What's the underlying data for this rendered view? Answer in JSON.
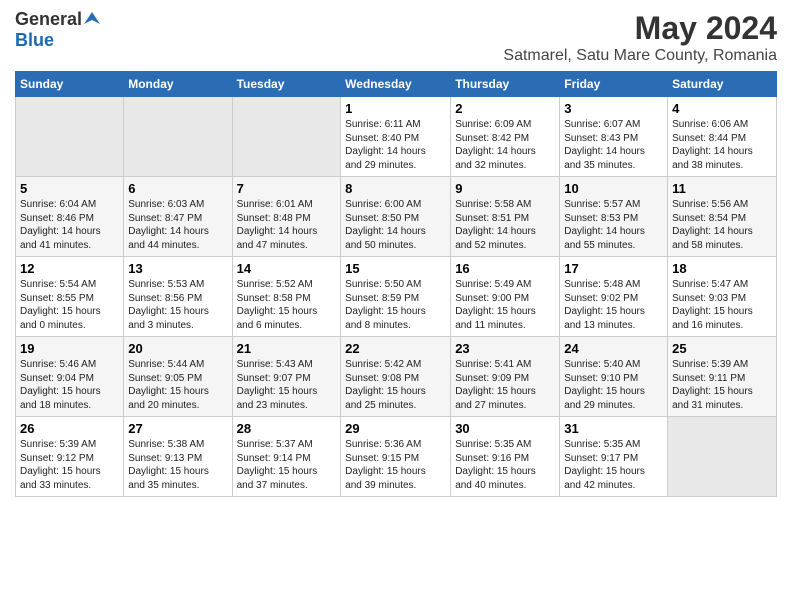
{
  "header": {
    "logo_general": "General",
    "logo_blue": "Blue",
    "title": "May 2024",
    "subtitle": "Satmarel, Satu Mare County, Romania"
  },
  "days_of_week": [
    "Sunday",
    "Monday",
    "Tuesday",
    "Wednesday",
    "Thursday",
    "Friday",
    "Saturday"
  ],
  "weeks": [
    [
      {
        "day": "",
        "info": ""
      },
      {
        "day": "",
        "info": ""
      },
      {
        "day": "",
        "info": ""
      },
      {
        "day": "1",
        "info": "Sunrise: 6:11 AM\nSunset: 8:40 PM\nDaylight: 14 hours\nand 29 minutes."
      },
      {
        "day": "2",
        "info": "Sunrise: 6:09 AM\nSunset: 8:42 PM\nDaylight: 14 hours\nand 32 minutes."
      },
      {
        "day": "3",
        "info": "Sunrise: 6:07 AM\nSunset: 8:43 PM\nDaylight: 14 hours\nand 35 minutes."
      },
      {
        "day": "4",
        "info": "Sunrise: 6:06 AM\nSunset: 8:44 PM\nDaylight: 14 hours\nand 38 minutes."
      }
    ],
    [
      {
        "day": "5",
        "info": "Sunrise: 6:04 AM\nSunset: 8:46 PM\nDaylight: 14 hours\nand 41 minutes."
      },
      {
        "day": "6",
        "info": "Sunrise: 6:03 AM\nSunset: 8:47 PM\nDaylight: 14 hours\nand 44 minutes."
      },
      {
        "day": "7",
        "info": "Sunrise: 6:01 AM\nSunset: 8:48 PM\nDaylight: 14 hours\nand 47 minutes."
      },
      {
        "day": "8",
        "info": "Sunrise: 6:00 AM\nSunset: 8:50 PM\nDaylight: 14 hours\nand 50 minutes."
      },
      {
        "day": "9",
        "info": "Sunrise: 5:58 AM\nSunset: 8:51 PM\nDaylight: 14 hours\nand 52 minutes."
      },
      {
        "day": "10",
        "info": "Sunrise: 5:57 AM\nSunset: 8:53 PM\nDaylight: 14 hours\nand 55 minutes."
      },
      {
        "day": "11",
        "info": "Sunrise: 5:56 AM\nSunset: 8:54 PM\nDaylight: 14 hours\nand 58 minutes."
      }
    ],
    [
      {
        "day": "12",
        "info": "Sunrise: 5:54 AM\nSunset: 8:55 PM\nDaylight: 15 hours\nand 0 minutes."
      },
      {
        "day": "13",
        "info": "Sunrise: 5:53 AM\nSunset: 8:56 PM\nDaylight: 15 hours\nand 3 minutes."
      },
      {
        "day": "14",
        "info": "Sunrise: 5:52 AM\nSunset: 8:58 PM\nDaylight: 15 hours\nand 6 minutes."
      },
      {
        "day": "15",
        "info": "Sunrise: 5:50 AM\nSunset: 8:59 PM\nDaylight: 15 hours\nand 8 minutes."
      },
      {
        "day": "16",
        "info": "Sunrise: 5:49 AM\nSunset: 9:00 PM\nDaylight: 15 hours\nand 11 minutes."
      },
      {
        "day": "17",
        "info": "Sunrise: 5:48 AM\nSunset: 9:02 PM\nDaylight: 15 hours\nand 13 minutes."
      },
      {
        "day": "18",
        "info": "Sunrise: 5:47 AM\nSunset: 9:03 PM\nDaylight: 15 hours\nand 16 minutes."
      }
    ],
    [
      {
        "day": "19",
        "info": "Sunrise: 5:46 AM\nSunset: 9:04 PM\nDaylight: 15 hours\nand 18 minutes."
      },
      {
        "day": "20",
        "info": "Sunrise: 5:44 AM\nSunset: 9:05 PM\nDaylight: 15 hours\nand 20 minutes."
      },
      {
        "day": "21",
        "info": "Sunrise: 5:43 AM\nSunset: 9:07 PM\nDaylight: 15 hours\nand 23 minutes."
      },
      {
        "day": "22",
        "info": "Sunrise: 5:42 AM\nSunset: 9:08 PM\nDaylight: 15 hours\nand 25 minutes."
      },
      {
        "day": "23",
        "info": "Sunrise: 5:41 AM\nSunset: 9:09 PM\nDaylight: 15 hours\nand 27 minutes."
      },
      {
        "day": "24",
        "info": "Sunrise: 5:40 AM\nSunset: 9:10 PM\nDaylight: 15 hours\nand 29 minutes."
      },
      {
        "day": "25",
        "info": "Sunrise: 5:39 AM\nSunset: 9:11 PM\nDaylight: 15 hours\nand 31 minutes."
      }
    ],
    [
      {
        "day": "26",
        "info": "Sunrise: 5:39 AM\nSunset: 9:12 PM\nDaylight: 15 hours\nand 33 minutes."
      },
      {
        "day": "27",
        "info": "Sunrise: 5:38 AM\nSunset: 9:13 PM\nDaylight: 15 hours\nand 35 minutes."
      },
      {
        "day": "28",
        "info": "Sunrise: 5:37 AM\nSunset: 9:14 PM\nDaylight: 15 hours\nand 37 minutes."
      },
      {
        "day": "29",
        "info": "Sunrise: 5:36 AM\nSunset: 9:15 PM\nDaylight: 15 hours\nand 39 minutes."
      },
      {
        "day": "30",
        "info": "Sunrise: 5:35 AM\nSunset: 9:16 PM\nDaylight: 15 hours\nand 40 minutes."
      },
      {
        "day": "31",
        "info": "Sunrise: 5:35 AM\nSunset: 9:17 PM\nDaylight: 15 hours\nand 42 minutes."
      },
      {
        "day": "",
        "info": ""
      }
    ]
  ]
}
